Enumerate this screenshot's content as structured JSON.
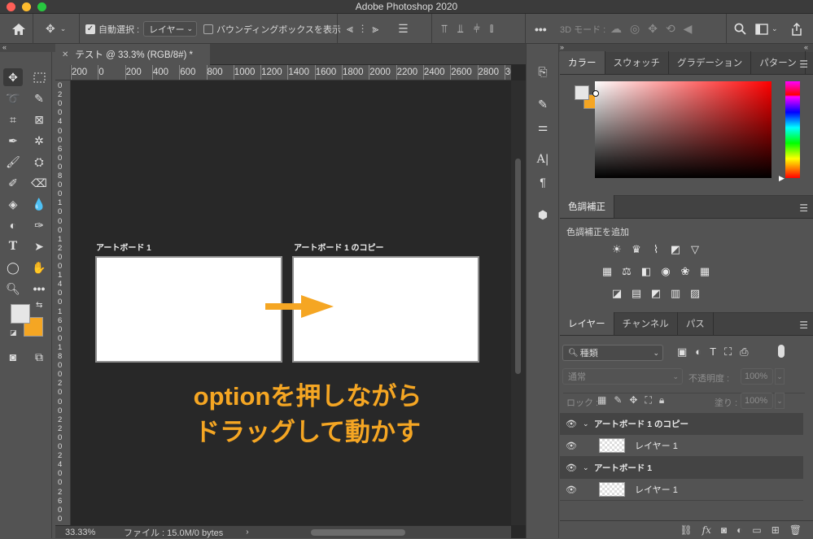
{
  "app": {
    "title": "Adobe Photoshop 2020"
  },
  "options": {
    "auto_select_label": "自動選択 :",
    "auto_select_value": "レイヤー",
    "bounding_box_label": "バウンディングボックスを表示",
    "mode_3d_label": "3D モード :"
  },
  "document": {
    "tab_label": "テスト @ 33.3% (RGB/8#) *",
    "zoom": "33.33%",
    "file_info": "ファイル : 15.0M/0 bytes"
  },
  "ruler": {
    "h_ticks": [
      "200",
      "0",
      "200",
      "400",
      "600",
      "800",
      "1000",
      "1200",
      "1400",
      "1600",
      "1800",
      "2000",
      "2200",
      "2400",
      "2600",
      "2800",
      "30"
    ],
    "v_ticks": [
      "0",
      "2",
      "0",
      "0",
      "4",
      "0",
      "0",
      "6",
      "0",
      "0",
      "8",
      "0",
      "0",
      "1",
      "0",
      "0",
      "0",
      "1",
      "2",
      "0",
      "0",
      "1",
      "4",
      "0",
      "0",
      "1",
      "6",
      "0",
      "0",
      "1",
      "8",
      "0",
      "0",
      "2",
      "0",
      "0",
      "0",
      "2",
      "2",
      "0",
      "0",
      "2",
      "4",
      "0",
      "0",
      "2",
      "6",
      "0",
      "0"
    ]
  },
  "artboards": [
    {
      "label": "アートボード 1"
    },
    {
      "label": "アートボード 1 のコピー"
    }
  ],
  "overlay": {
    "line1": "optionを押しながら",
    "line2": "ドラッグして動かす",
    "color": "#f5a623"
  },
  "color_panel": {
    "tabs": [
      "カラー",
      "スウォッチ",
      "グラデーション",
      "パターン"
    ],
    "foreground": "#e6e6e6",
    "background": "#f5a623"
  },
  "adjustments_panel": {
    "tab": "色調補正",
    "subtitle": "色調補正を追加"
  },
  "layers_panel": {
    "tabs": [
      "レイヤー",
      "チャンネル",
      "パス"
    ],
    "filter_kind": "種類",
    "blend_mode": "通常",
    "opacity_label": "不透明度 :",
    "opacity_value": "100%",
    "lock_label": "ロック :",
    "fill_label": "塗り :",
    "fill_value": "100%",
    "layers": [
      {
        "name": "アートボード 1 のコピー",
        "type": "artboard"
      },
      {
        "name": "レイヤー 1",
        "type": "layer"
      },
      {
        "name": "アートボード 1",
        "type": "artboard"
      },
      {
        "name": "レイヤー 1",
        "type": "layer"
      }
    ]
  }
}
